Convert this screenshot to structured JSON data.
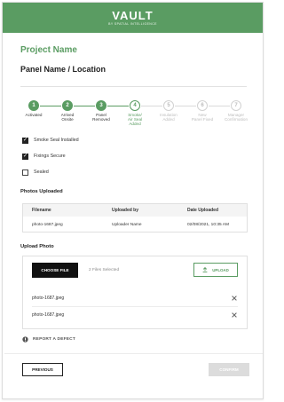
{
  "header": {
    "logo": "VAULT",
    "logo_sub": "BY SPATIAL INTELLIGENCE",
    "bg_color": "#5a9c62"
  },
  "page": {
    "project_name": "Project Name",
    "panel_name": "Panel Name / Location"
  },
  "steps": [
    {
      "num": "1",
      "label": [
        "Activated"
      ],
      "state": "done"
    },
    {
      "num": "2",
      "label": [
        "Arrived",
        "Onsite"
      ],
      "state": "done"
    },
    {
      "num": "3",
      "label": [
        "Panel",
        "Removed"
      ],
      "state": "done"
    },
    {
      "num": "4",
      "label": [
        "Smoke/",
        "Air Seal Added"
      ],
      "state": "active"
    },
    {
      "num": "5",
      "label": [
        "Insulation",
        "Added"
      ],
      "state": "future"
    },
    {
      "num": "6",
      "label": [
        "New",
        "Panel Fixed"
      ],
      "state": "future"
    },
    {
      "num": "7",
      "label": [
        "Manager",
        "Confirmation"
      ],
      "state": "future"
    }
  ],
  "checks": [
    {
      "label": "Smoke Seal Installed",
      "checked": true
    },
    {
      "label": "Fixings Secure",
      "checked": true
    },
    {
      "label": "Sealed",
      "checked": false
    }
  ],
  "photos": {
    "title": "Photos Uploaded",
    "headers": [
      "Filename",
      "Uploaded by",
      "Date Uploaded"
    ],
    "rows": [
      [
        "photo-1687.jpeg",
        "Uploader Name",
        "02/08/2021, 10:35 AM"
      ]
    ]
  },
  "upload": {
    "title": "Upload Photo",
    "choose_label": "CHOOSE FILE",
    "files_selected": "2 Files Selected",
    "upload_label": "UPLOAD",
    "files": [
      "photo-1687.jpeg",
      "photo-1687.jpeg"
    ]
  },
  "report_label": "REPORT A DEFECT",
  "footer": {
    "previous_label": "PREVIOUS",
    "confirm_label": "CONFIRM"
  },
  "colors": {
    "accent": "#5a9c62",
    "disabled": "#dcdcdc",
    "dark": "#111111"
  }
}
